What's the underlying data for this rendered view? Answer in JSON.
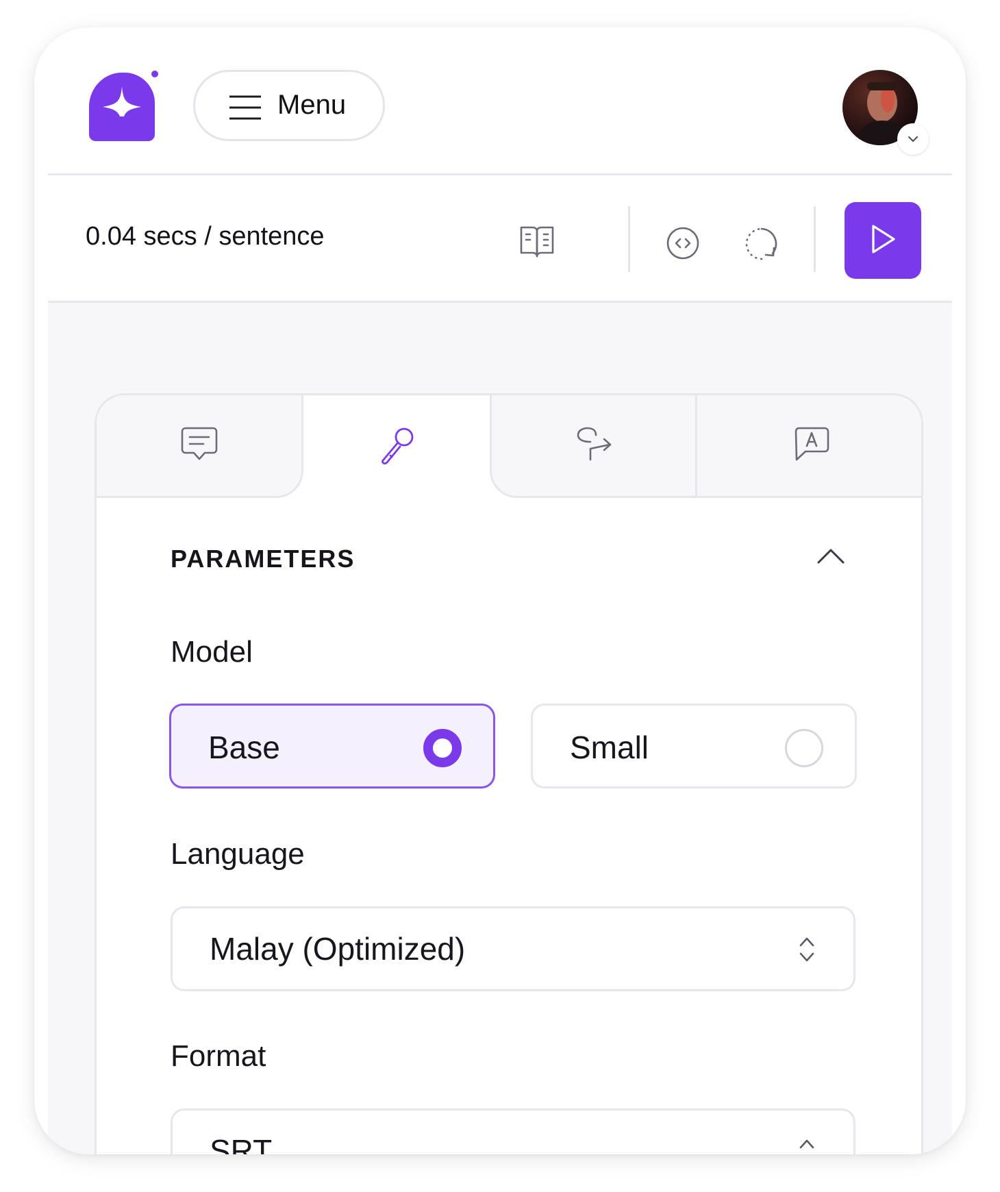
{
  "colors": {
    "accent": "#7a3aea",
    "accent_light": "#f4f0fe",
    "border": "#e6e6ec"
  },
  "header": {
    "logo_icon": "sparkle-logo-icon",
    "menu_label": "Menu",
    "avatar_icon": "user-avatar"
  },
  "toolbar": {
    "speed": "0.04 secs / sentence",
    "icons": [
      "book-open-icon",
      "code-icon",
      "reset-icon",
      "play-icon"
    ]
  },
  "tabs": [
    {
      "icon": "chat-icon",
      "active": false
    },
    {
      "icon": "microphone-icon",
      "active": true
    },
    {
      "icon": "redirect-arrow-icon",
      "active": false
    },
    {
      "icon": "chat-a-icon",
      "active": false
    }
  ],
  "parameters": {
    "title": "PARAMETERS",
    "model": {
      "label": "Model",
      "options": [
        {
          "label": "Base",
          "selected": true
        },
        {
          "label": "Small",
          "selected": false
        }
      ]
    },
    "language": {
      "label": "Language",
      "value": "Malay (Optimized)"
    },
    "format": {
      "label": "Format",
      "value": "SRT"
    }
  }
}
